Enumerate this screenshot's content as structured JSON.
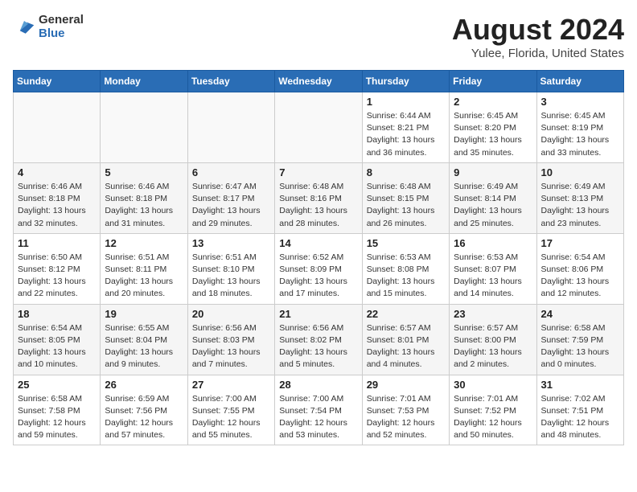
{
  "header": {
    "logo_general": "General",
    "logo_blue": "Blue",
    "month_year": "August 2024",
    "location": "Yulee, Florida, United States"
  },
  "weekdays": [
    "Sunday",
    "Monday",
    "Tuesday",
    "Wednesday",
    "Thursday",
    "Friday",
    "Saturday"
  ],
  "weeks": [
    [
      {
        "day": "",
        "info": ""
      },
      {
        "day": "",
        "info": ""
      },
      {
        "day": "",
        "info": ""
      },
      {
        "day": "",
        "info": ""
      },
      {
        "day": "1",
        "info": "Sunrise: 6:44 AM\nSunset: 8:21 PM\nDaylight: 13 hours and 36 minutes."
      },
      {
        "day": "2",
        "info": "Sunrise: 6:45 AM\nSunset: 8:20 PM\nDaylight: 13 hours and 35 minutes."
      },
      {
        "day": "3",
        "info": "Sunrise: 6:45 AM\nSunset: 8:19 PM\nDaylight: 13 hours and 33 minutes."
      }
    ],
    [
      {
        "day": "4",
        "info": "Sunrise: 6:46 AM\nSunset: 8:18 PM\nDaylight: 13 hours and 32 minutes."
      },
      {
        "day": "5",
        "info": "Sunrise: 6:46 AM\nSunset: 8:18 PM\nDaylight: 13 hours and 31 minutes."
      },
      {
        "day": "6",
        "info": "Sunrise: 6:47 AM\nSunset: 8:17 PM\nDaylight: 13 hours and 29 minutes."
      },
      {
        "day": "7",
        "info": "Sunrise: 6:48 AM\nSunset: 8:16 PM\nDaylight: 13 hours and 28 minutes."
      },
      {
        "day": "8",
        "info": "Sunrise: 6:48 AM\nSunset: 8:15 PM\nDaylight: 13 hours and 26 minutes."
      },
      {
        "day": "9",
        "info": "Sunrise: 6:49 AM\nSunset: 8:14 PM\nDaylight: 13 hours and 25 minutes."
      },
      {
        "day": "10",
        "info": "Sunrise: 6:49 AM\nSunset: 8:13 PM\nDaylight: 13 hours and 23 minutes."
      }
    ],
    [
      {
        "day": "11",
        "info": "Sunrise: 6:50 AM\nSunset: 8:12 PM\nDaylight: 13 hours and 22 minutes."
      },
      {
        "day": "12",
        "info": "Sunrise: 6:51 AM\nSunset: 8:11 PM\nDaylight: 13 hours and 20 minutes."
      },
      {
        "day": "13",
        "info": "Sunrise: 6:51 AM\nSunset: 8:10 PM\nDaylight: 13 hours and 18 minutes."
      },
      {
        "day": "14",
        "info": "Sunrise: 6:52 AM\nSunset: 8:09 PM\nDaylight: 13 hours and 17 minutes."
      },
      {
        "day": "15",
        "info": "Sunrise: 6:53 AM\nSunset: 8:08 PM\nDaylight: 13 hours and 15 minutes."
      },
      {
        "day": "16",
        "info": "Sunrise: 6:53 AM\nSunset: 8:07 PM\nDaylight: 13 hours and 14 minutes."
      },
      {
        "day": "17",
        "info": "Sunrise: 6:54 AM\nSunset: 8:06 PM\nDaylight: 13 hours and 12 minutes."
      }
    ],
    [
      {
        "day": "18",
        "info": "Sunrise: 6:54 AM\nSunset: 8:05 PM\nDaylight: 13 hours and 10 minutes."
      },
      {
        "day": "19",
        "info": "Sunrise: 6:55 AM\nSunset: 8:04 PM\nDaylight: 13 hours and 9 minutes."
      },
      {
        "day": "20",
        "info": "Sunrise: 6:56 AM\nSunset: 8:03 PM\nDaylight: 13 hours and 7 minutes."
      },
      {
        "day": "21",
        "info": "Sunrise: 6:56 AM\nSunset: 8:02 PM\nDaylight: 13 hours and 5 minutes."
      },
      {
        "day": "22",
        "info": "Sunrise: 6:57 AM\nSunset: 8:01 PM\nDaylight: 13 hours and 4 minutes."
      },
      {
        "day": "23",
        "info": "Sunrise: 6:57 AM\nSunset: 8:00 PM\nDaylight: 13 hours and 2 minutes."
      },
      {
        "day": "24",
        "info": "Sunrise: 6:58 AM\nSunset: 7:59 PM\nDaylight: 13 hours and 0 minutes."
      }
    ],
    [
      {
        "day": "25",
        "info": "Sunrise: 6:58 AM\nSunset: 7:58 PM\nDaylight: 12 hours and 59 minutes."
      },
      {
        "day": "26",
        "info": "Sunrise: 6:59 AM\nSunset: 7:56 PM\nDaylight: 12 hours and 57 minutes."
      },
      {
        "day": "27",
        "info": "Sunrise: 7:00 AM\nSunset: 7:55 PM\nDaylight: 12 hours and 55 minutes."
      },
      {
        "day": "28",
        "info": "Sunrise: 7:00 AM\nSunset: 7:54 PM\nDaylight: 12 hours and 53 minutes."
      },
      {
        "day": "29",
        "info": "Sunrise: 7:01 AM\nSunset: 7:53 PM\nDaylight: 12 hours and 52 minutes."
      },
      {
        "day": "30",
        "info": "Sunrise: 7:01 AM\nSunset: 7:52 PM\nDaylight: 12 hours and 50 minutes."
      },
      {
        "day": "31",
        "info": "Sunrise: 7:02 AM\nSunset: 7:51 PM\nDaylight: 12 hours and 48 minutes."
      }
    ]
  ]
}
